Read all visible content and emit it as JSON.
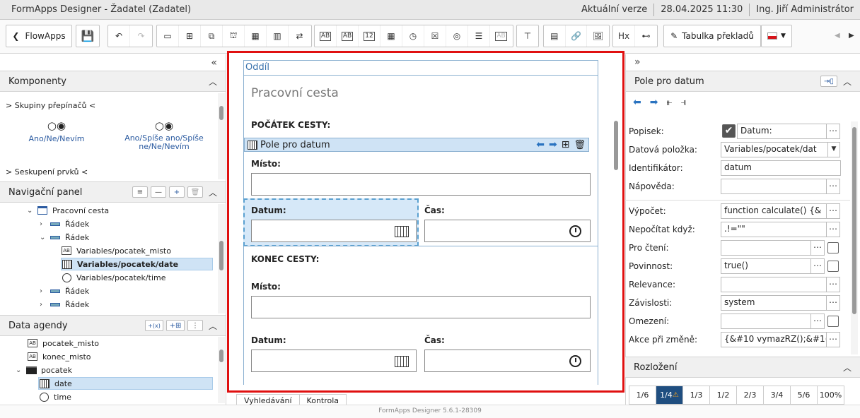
{
  "titlebar": {
    "app": "FormApps Designer - Žadatel (Zadatel)",
    "version": "Aktuální verze",
    "datetime": "28.04.2025 11:30",
    "user": "Ing. Jiří Administrátor"
  },
  "toolbar": {
    "flowapps": "FlowApps",
    "translation": "Tabulka překladů",
    "tool_ab": "AB",
    "tool_12": "12",
    "tool_hx": "Hx"
  },
  "left": {
    "components_title": "Komponenty",
    "group_radio": "> Skupiny přepínačů <",
    "radio1_glyph": "○◉",
    "radio1": "Ano/Ne/Nevím",
    "radio2_glyph": "○◉",
    "radio2": "Ano/Spíše ano/Spíše ne/Ne/Nevím",
    "group_elements": "> Seskupení prvků <",
    "nav_title": "Navigační panel",
    "tree": [
      {
        "label": "Pracovní cesta"
      },
      {
        "label": "Řádek"
      },
      {
        "label": "Řádek"
      },
      {
        "label": "Variables/pocatek_misto"
      },
      {
        "label": "Variables/pocatek/date"
      },
      {
        "label": "Variables/pocatek/time"
      },
      {
        "label": "Řádek"
      },
      {
        "label": "Řádek"
      }
    ],
    "data_title": "Data agendy",
    "data_btn_fx": "+(x)",
    "data_tree": [
      {
        "label": "pocatek_misto"
      },
      {
        "label": "konec_misto"
      },
      {
        "label": "pocatek"
      },
      {
        "label": "date"
      },
      {
        "label": "time"
      }
    ]
  },
  "form": {
    "section": "Oddíl",
    "heading": "Pracovní cesta",
    "start": "POČÁTEK CESTY:",
    "selected": "Pole pro datum",
    "misto": "Místo:",
    "datum": "Datum:",
    "cas": "Čas:",
    "end": "KONEC CESTY:",
    "misto2": "Místo:",
    "datum2": "Datum:",
    "cas2": "Čas:"
  },
  "tabs": [
    "Vyhledávání",
    "Kontrola"
  ],
  "footer": "FormApps Designer 5.6.1-28309",
  "right": {
    "title": "Pole pro datum",
    "props": [
      {
        "label": "Popisek:",
        "value": "Datum:"
      },
      {
        "label": "Datová položka:",
        "value": "Variables/pocatek/dat"
      },
      {
        "label": "Identifikátor:",
        "value": "datum"
      },
      {
        "label": "Nápověda:",
        "value": ""
      },
      {
        "label": "Výpočet:",
        "value": "function calculate() {&"
      },
      {
        "label": "Nepočítat když:",
        "value": ".!=\"\""
      },
      {
        "label": "Pro čtení:",
        "value": ""
      },
      {
        "label": "Povinnost:",
        "value": "true()"
      },
      {
        "label": "Relevance:",
        "value": ""
      },
      {
        "label": "Závislosti:",
        "value": "system"
      },
      {
        "label": "Omezení:",
        "value": ""
      },
      {
        "label": "Akce při změně:",
        "value": "{&#10  vymazRZ();&#1("
      }
    ],
    "layout_title": "Rozložení",
    "layout": [
      "1/6",
      "1/4",
      "1/3",
      "1/2",
      "2/3",
      "3/4",
      "5/6",
      "100%"
    ]
  }
}
